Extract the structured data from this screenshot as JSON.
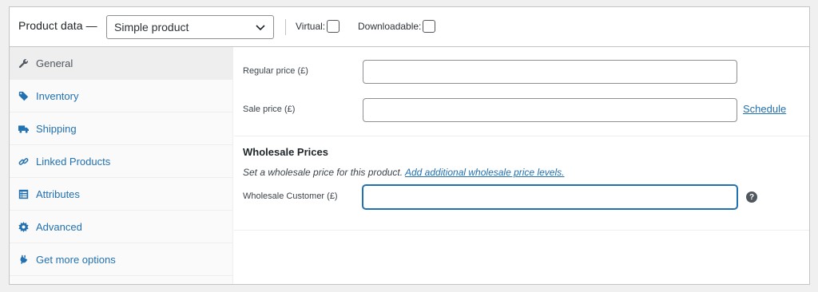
{
  "header": {
    "title": "Product data —",
    "product_type": "Simple product",
    "virtual_label": "Virtual:",
    "downloadable_label": "Downloadable:"
  },
  "tabs": [
    {
      "label": "General",
      "icon": "wrench-icon",
      "active": true
    },
    {
      "label": "Inventory",
      "icon": "tag-icon"
    },
    {
      "label": "Shipping",
      "icon": "truck-icon"
    },
    {
      "label": "Linked Products",
      "icon": "link-icon"
    },
    {
      "label": "Attributes",
      "icon": "list-icon"
    },
    {
      "label": "Advanced",
      "icon": "gear-icon"
    },
    {
      "label": "Get more options",
      "icon": "plugin-icon"
    }
  ],
  "pricing": {
    "regular_label": "Regular price (£)",
    "regular_value": "",
    "sale_label": "Sale price (£)",
    "sale_value": "",
    "schedule_link": "Schedule"
  },
  "wholesale": {
    "title": "Wholesale Prices",
    "description": "Set a wholesale price for this product.",
    "levels_link": "Add additional wholesale price levels.",
    "customer_label": "Wholesale Customer (£)",
    "customer_value": "",
    "help_glyph": "?"
  },
  "colors": {
    "link": "#2271b1",
    "active_tab_bg": "#eeeeee",
    "border": "#c3c4c7"
  }
}
